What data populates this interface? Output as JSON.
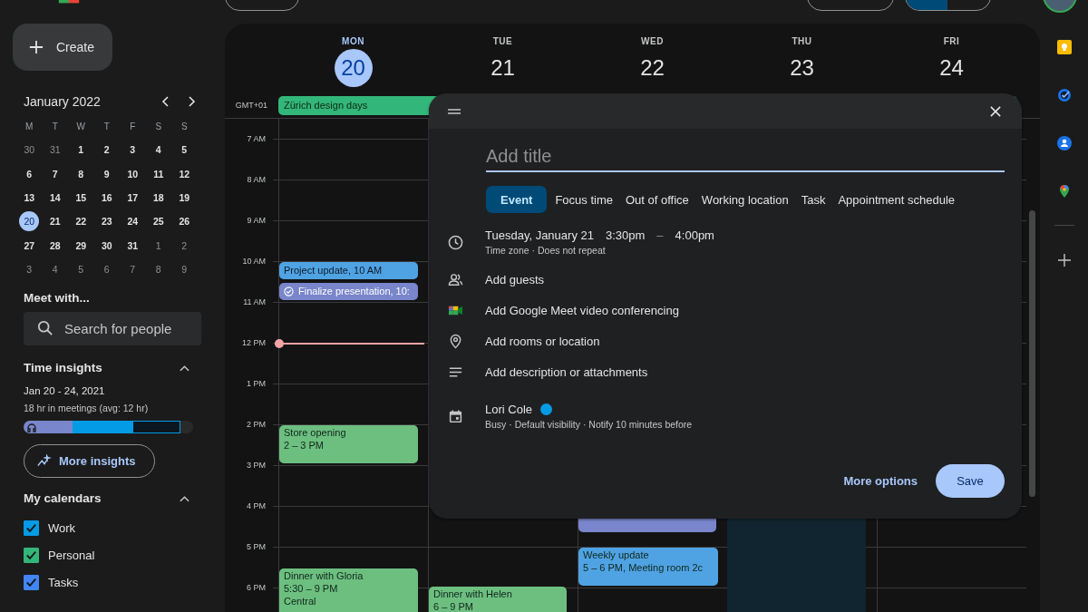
{
  "sidebar": {
    "create_button": "Create",
    "mini_calendar": {
      "title": "January 2022",
      "weekdays": [
        "M",
        "T",
        "W",
        "T",
        "F",
        "S",
        "S"
      ],
      "weeks": [
        [
          {
            "day": "30",
            "muted": true,
            "selected": false
          },
          {
            "day": "31",
            "muted": true,
            "selected": false
          },
          {
            "day": "1",
            "muted": false,
            "selected": false
          },
          {
            "day": "2",
            "muted": false,
            "selected": false
          },
          {
            "day": "3",
            "muted": false,
            "selected": false
          },
          {
            "day": "4",
            "muted": false,
            "selected": false
          },
          {
            "day": "5",
            "muted": false,
            "selected": false
          }
        ],
        [
          {
            "day": "6",
            "muted": false,
            "selected": false
          },
          {
            "day": "7",
            "muted": false,
            "selected": false
          },
          {
            "day": "8",
            "muted": false,
            "selected": false
          },
          {
            "day": "9",
            "muted": false,
            "selected": false
          },
          {
            "day": "10",
            "muted": false,
            "selected": false
          },
          {
            "day": "11",
            "muted": false,
            "selected": false
          },
          {
            "day": "12",
            "muted": false,
            "selected": false
          }
        ],
        [
          {
            "day": "13",
            "muted": false,
            "selected": false
          },
          {
            "day": "14",
            "muted": false,
            "selected": false
          },
          {
            "day": "15",
            "muted": false,
            "selected": false
          },
          {
            "day": "16",
            "muted": false,
            "selected": false
          },
          {
            "day": "17",
            "muted": false,
            "selected": false
          },
          {
            "day": "18",
            "muted": false,
            "selected": false
          },
          {
            "day": "19",
            "muted": false,
            "selected": false
          }
        ],
        [
          {
            "day": "20",
            "muted": false,
            "selected": true
          },
          {
            "day": "21",
            "muted": false,
            "selected": false
          },
          {
            "day": "22",
            "muted": false,
            "selected": false
          },
          {
            "day": "23",
            "muted": false,
            "selected": false
          },
          {
            "day": "24",
            "muted": false,
            "selected": false
          },
          {
            "day": "25",
            "muted": false,
            "selected": false
          },
          {
            "day": "26",
            "muted": false,
            "selected": false
          }
        ],
        [
          {
            "day": "27",
            "muted": false,
            "selected": false
          },
          {
            "day": "28",
            "muted": false,
            "selected": false
          },
          {
            "day": "29",
            "muted": false,
            "selected": false
          },
          {
            "day": "30",
            "muted": false,
            "selected": false
          },
          {
            "day": "31",
            "muted": false,
            "selected": false
          },
          {
            "day": "1",
            "muted": true,
            "selected": false
          },
          {
            "day": "2",
            "muted": true,
            "selected": false
          }
        ],
        [
          {
            "day": "3",
            "muted": true,
            "selected": false
          },
          {
            "day": "4",
            "muted": true,
            "selected": false
          },
          {
            "day": "5",
            "muted": true,
            "selected": false
          },
          {
            "day": "6",
            "muted": true,
            "selected": false
          },
          {
            "day": "7",
            "muted": true,
            "selected": false
          },
          {
            "day": "8",
            "muted": true,
            "selected": false
          },
          {
            "day": "9",
            "muted": true,
            "selected": false
          }
        ]
      ]
    },
    "meet_with": {
      "title": "Meet with...",
      "placeholder": "Search for people"
    },
    "time_insights": {
      "title": "Time insights",
      "expanded": true,
      "range": "Jan 20 - 24, 2021",
      "summary": "18 hr in meetings (avg: 12 hr)",
      "button": "More insights"
    },
    "my_calendars": {
      "title": "My calendars",
      "expanded": true,
      "items": [
        {
          "label": "Work",
          "checked": true,
          "color": "#039be5"
        },
        {
          "label": "Personal",
          "checked": true,
          "color": "#33b679"
        },
        {
          "label": "Tasks",
          "checked": true,
          "color": "#4285f4"
        }
      ]
    }
  },
  "week": {
    "timezone": "GMT+01",
    "days": [
      {
        "weekday": "MON",
        "date": "20",
        "selected": true
      },
      {
        "weekday": "TUE",
        "date": "21",
        "selected": false
      },
      {
        "weekday": "WED",
        "date": "22",
        "selected": false
      },
      {
        "weekday": "THU",
        "date": "23",
        "selected": false
      },
      {
        "weekday": "FRI",
        "date": "24",
        "selected": false
      }
    ],
    "all_day": [
      {
        "title": "Zürich design days",
        "color": "#33b679"
      }
    ],
    "hours": [
      "7 AM",
      "8 AM",
      "9 AM",
      "10 AM",
      "11 AM",
      "12 PM",
      "1 PM",
      "2 PM",
      "3 PM",
      "4 PM",
      "5 PM",
      "6 PM"
    ],
    "events": [
      {
        "kind": "chip",
        "title": "Project update, 10 AM",
        "color": "#4fa3e3"
      },
      {
        "kind": "task",
        "title": "Finalize presentation, 10:",
        "color": "#7986cb"
      },
      {
        "kind": "block",
        "title": "Store opening",
        "time": "2 – 3 PM",
        "color": "#6dbf80"
      },
      {
        "kind": "block",
        "title": "Dinner with Gloria",
        "time": "5:30 – 9 PM",
        "place": "Central",
        "color": "#6dbf80"
      },
      {
        "kind": "block",
        "title": "Dinner with Helen",
        "time": "6 – 9 PM",
        "color": "#6dbf80"
      },
      {
        "kind": "hidden",
        "color": "#7986cb"
      },
      {
        "kind": "block",
        "title": "Weekly update",
        "time": "5 – 6 PM, Meeting room 2c",
        "color": "#4fa3e3"
      },
      {
        "kind": "slot",
        "color": "#10252f"
      }
    ]
  },
  "dialog": {
    "title_placeholder": "Add title",
    "types": [
      {
        "label": "Event",
        "selected": true
      },
      {
        "label": "Focus time",
        "selected": false
      },
      {
        "label": "Out of office",
        "selected": false
      },
      {
        "label": "Working location",
        "selected": false
      },
      {
        "label": "Task",
        "selected": false
      },
      {
        "label": "Appointment schedule",
        "selected": false
      }
    ],
    "date": "Tuesday, January 21",
    "start": "3:30pm",
    "dash": "–",
    "end": "4:00pm",
    "date_details": "Time zone · Does not repeat",
    "rows": [
      {
        "kind": "guests",
        "label": "Add guests"
      },
      {
        "kind": "meet",
        "label": "Add Google Meet video conferencing"
      },
      {
        "kind": "location",
        "label": "Add rooms or location"
      },
      {
        "kind": "description",
        "label": "Add description or attachments"
      }
    ],
    "calendar": {
      "name": "Lori Cole",
      "color": "#039be5",
      "details": "Busy · Default visibility · Notify 10 minutes before"
    },
    "more_options": "More options",
    "save": "Save"
  }
}
